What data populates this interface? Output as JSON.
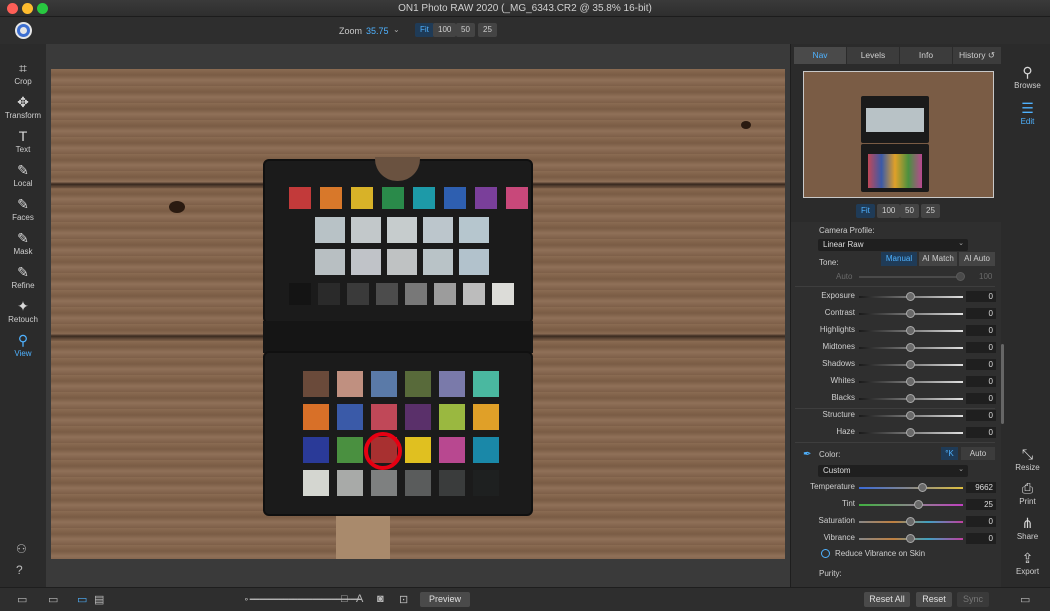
{
  "window": {
    "title": "ON1 Photo RAW 2020 (_MG_6343.CR2 @ 35.8% 16-bit)"
  },
  "toolbar": {
    "zoom_label": "Zoom",
    "zoom_value": "35.75",
    "zoom_buttons": [
      "Fit",
      "100",
      "50",
      "25"
    ],
    "zoom_active": "Fit"
  },
  "left_tools": [
    {
      "label": "Crop",
      "icon": "crop-icon"
    },
    {
      "label": "Transform",
      "icon": "transform-icon"
    },
    {
      "label": "Text",
      "icon": "text-icon"
    },
    {
      "label": "Local",
      "icon": "local-brush-icon"
    },
    {
      "label": "Faces",
      "icon": "faces-icon"
    },
    {
      "label": "Mask",
      "icon": "mask-brush-icon"
    },
    {
      "label": "Refine",
      "icon": "refine-brush-icon"
    },
    {
      "label": "Retouch",
      "icon": "retouch-icon"
    },
    {
      "label": "View",
      "icon": "view-zoom-icon",
      "active": true
    }
  ],
  "right_tabs": [
    {
      "label": "Nav",
      "active": true
    },
    {
      "label": "Levels"
    },
    {
      "label": "Info"
    },
    {
      "label": "History"
    }
  ],
  "nav_zoom_buttons": [
    "Fit",
    "100",
    "50",
    "25"
  ],
  "develop": {
    "camera_profile_label": "Camera Profile:",
    "camera_profile_value": "Linear Raw",
    "tone_label": "Tone:",
    "tone_modes": [
      "Manual",
      "AI Match",
      "AI Auto"
    ],
    "tone_active": "Manual",
    "auto_label": "Auto",
    "auto_value": "100",
    "tone_sliders": [
      {
        "label": "Exposure",
        "value": "0"
      },
      {
        "label": "Contrast",
        "value": "0"
      },
      {
        "label": "Highlights",
        "value": "0"
      },
      {
        "label": "Midtones",
        "value": "0"
      },
      {
        "label": "Shadows",
        "value": "0"
      },
      {
        "label": "Whites",
        "value": "0"
      },
      {
        "label": "Blacks",
        "value": "0"
      }
    ],
    "detail_sliders": [
      {
        "label": "Structure",
        "value": "0"
      },
      {
        "label": "Haze",
        "value": "0"
      }
    ],
    "color_label": "Color:",
    "kelvin_label": "°K",
    "auto_button": "Auto",
    "wb_preset": "Custom",
    "color_sliders": [
      {
        "label": "Temperature",
        "value": "9662",
        "pos": 0.62,
        "track": "temp"
      },
      {
        "label": "Tint",
        "value": "25",
        "pos": 0.58,
        "track": "tint"
      },
      {
        "label": "Saturation",
        "value": "0",
        "pos": 0.5,
        "track": "sat"
      },
      {
        "label": "Vibrance",
        "value": "0",
        "pos": 0.5,
        "track": "sat"
      }
    ],
    "vibrance_skin_label": "Reduce Vibrance on Skin",
    "purity_label": "Purity:"
  },
  "modules": [
    {
      "label": "Browse",
      "icon": "browse-icon"
    },
    {
      "label": "Edit",
      "icon": "edit-sliders-icon",
      "active": true
    },
    {
      "label": "Resize",
      "icon": "resize-icon"
    },
    {
      "label": "Print",
      "icon": "print-icon"
    },
    {
      "label": "Share",
      "icon": "share-icon"
    },
    {
      "label": "Export",
      "icon": "export-icon"
    }
  ],
  "bottom": {
    "preview_label": "Preview",
    "reset_all_label": "Reset All",
    "reset_label": "Reset",
    "sync_label": "Sync"
  },
  "colors": {
    "accent": "#4fb2ff",
    "circle_marker": "#e60012"
  }
}
